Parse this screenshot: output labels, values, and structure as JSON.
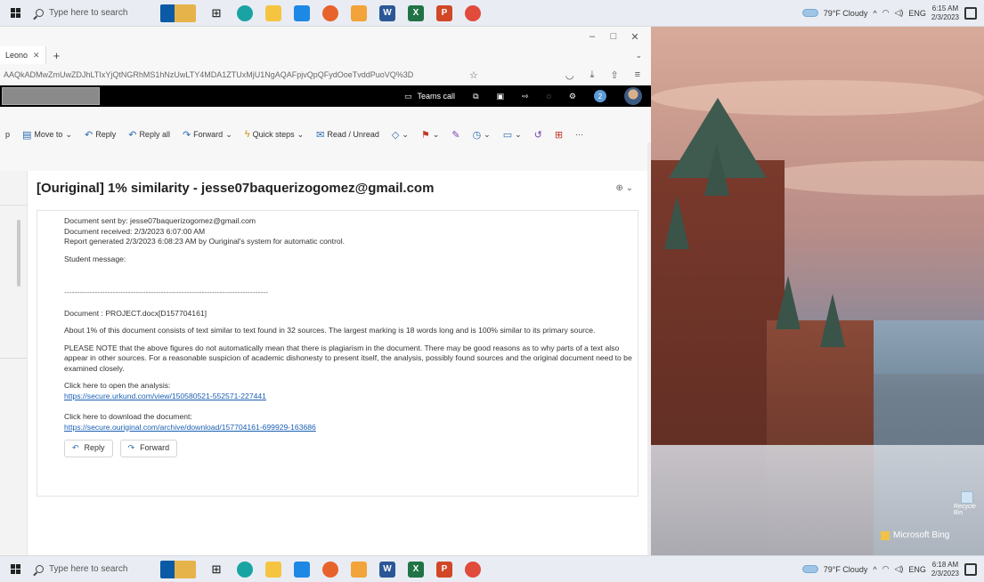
{
  "taskbar": {
    "search_placeholder": "Type here to search",
    "weather": "79°F  Cloudy",
    "lang": "ENG",
    "top_time": "6:15 AM",
    "top_date": "2/3/2023",
    "bottom_time": "6:18 AM",
    "bottom_date": "2/3/2023"
  },
  "browser": {
    "tab_label": "Leono",
    "url": "AAQkADMwZmUwZDJhLTIxYjQtNGRhMS1hNzUwLTY4MDA1ZTUxMjU1NgAQAFpjvQpQFydOoeTvddPuoVQ%3D"
  },
  "outlook": {
    "teams_call": "Teams call",
    "notif_count": "2",
    "ribbon": {
      "move_to": "Move to",
      "reply": "Reply",
      "reply_all": "Reply all",
      "forward": "Forward",
      "quick_steps": "Quick steps",
      "read_unread": "Read / Unread",
      "more": "···"
    },
    "subject": "[Ouriginal] 1% similarity - jesse07baquerizogomez@gmail.com",
    "body": {
      "sent_by": "Document sent by: jesse07baquerizogomez@gmail.com",
      "received": "Document received: 2/3/2023 6:07:00 AM",
      "generated": "Report generated 2/3/2023 6:08:23 AM by Ouriginal's system for automatic control.",
      "student_message": "Student message:",
      "divider": "--------------------------------------------------------------------------------",
      "document": "Document : PROJECT.docx[D157704161]",
      "about": "About 1% of this document consists of text similar to text found in 32 sources. The largest marking is 18 words long and is 100% similar to its primary source.",
      "note": "PLEASE NOTE that the above figures do not automatically mean that there is plagiarism in the document. There may be good reasons as to why parts of a text also appear in other sources. For a reasonable suspicion of academic dishonesty to present itself, the analysis, possibly found sources and the original document need to be examined closely.",
      "open_label": "Click here to open the analysis:",
      "open_link": "https://secure.urkund.com/view/150580521-552571-227441",
      "download_label": "Click here to download the document:",
      "download_link": "https://secure.ouriginal.com/archive/download/157704161-699929-163686"
    },
    "actions": {
      "reply": "Reply",
      "forward": "Forward"
    }
  },
  "desktop": {
    "bing_label": "Microsoft Bing",
    "recycle_label": "Recycle Bin"
  },
  "colors": {
    "link": "#1a5fb4",
    "accent": "#2b6cb0",
    "header_bg": "#000000"
  }
}
